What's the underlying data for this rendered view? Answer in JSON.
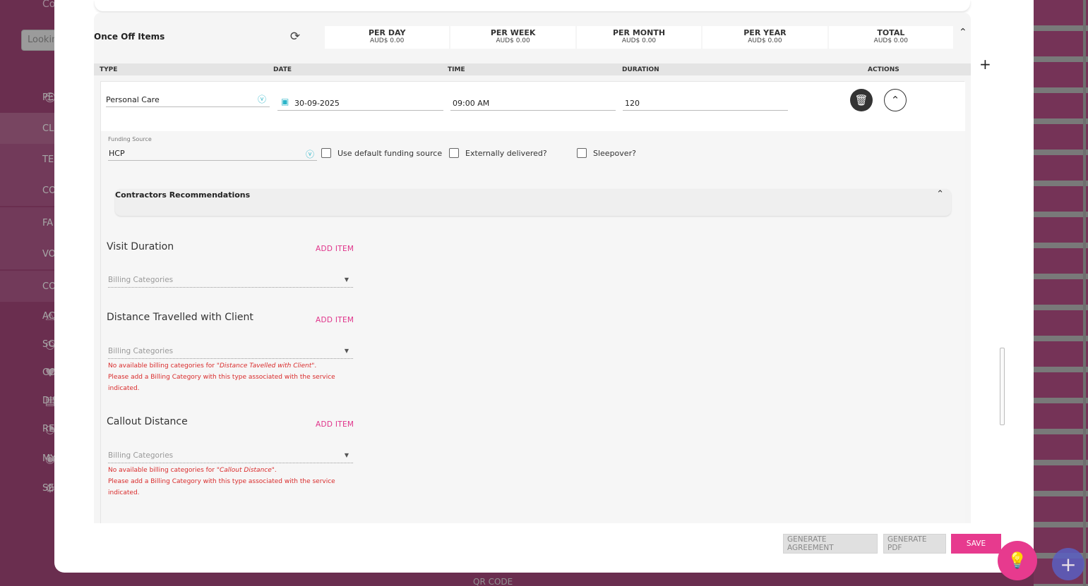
{
  "background": {
    "sidebar_search_placeholder": "Lookin",
    "sidebar_top_text": "Co",
    "sidebar_items": [
      "PE",
      "CL",
      "TE",
      "CO",
      "FA",
      "VO",
      "CO",
      "AC",
      "SC",
      "CO",
      "DIS",
      "RE",
      "MY",
      "SE"
    ],
    "bottom_text": "QR CODE"
  },
  "section": {
    "title": "Once Off Items",
    "totals": [
      {
        "label": "PER DAY",
        "value": "AUD$ 0.00"
      },
      {
        "label": "PER WEEK",
        "value": "AUD$ 0.00"
      },
      {
        "label": "PER MONTH",
        "value": "AUD$ 0.00"
      },
      {
        "label": "PER YEAR",
        "value": "AUD$ 0.00"
      },
      {
        "label": "TOTAL",
        "value": "AUD$ 0.00"
      }
    ],
    "columns": {
      "type": "TYPE",
      "date": "DATE",
      "time": "TIME",
      "duration": "DURATION",
      "actions": "ACTIONS"
    }
  },
  "item": {
    "type": "Personal Care",
    "date": "30-09-2025",
    "time": "09:00 AM",
    "duration": "120",
    "funding_source_label": "Funding Source",
    "funding_source": "HCP",
    "use_default_label": "Use default funding source",
    "externally_label": "Externally delivered?",
    "sleepover_label": "Sleepover?",
    "contractors_title": "Contractors Recommendations"
  },
  "blocks": [
    {
      "title": "Visit Duration",
      "add": "ADD ITEM",
      "select_placeholder": "Billing Categories"
    },
    {
      "title": "Distance Travelled with Client",
      "add": "ADD ITEM",
      "select_placeholder": "Billing Categories",
      "error_prefix": "No available billing categories for ",
      "error_name": "\"Distance Tavelled with Client\"",
      "error_suffix": ".",
      "error_line2": "Please add a Billing Category with this type associated with the service",
      "error_line3": "indicated."
    },
    {
      "title": "Callout Distance",
      "add": "ADD ITEM",
      "select_placeholder": "Billing Categories",
      "error_prefix": "No available billing categories for ",
      "error_name": "\"Callout Distance\"",
      "error_suffix": ".",
      "error_line2": "Please add a Billing Category with this type associated with the service",
      "error_line3": "indicated."
    }
  ],
  "footer": {
    "generate_agreement": "GENERATE AGREEMENT",
    "generate_pdf": "GENERATE PDF",
    "save": "SAVE"
  },
  "colors": {
    "accent": "#e73a8e",
    "cyan": "#2bb5c9",
    "error": "#d92b2b",
    "fab_secondary": "#5a5fc0"
  },
  "icons": [
    "refresh-icon",
    "chevron-up-icon",
    "calendar-icon",
    "cyan-dropdown-icon",
    "trash-icon",
    "plus-icon",
    "lightbulb-icon"
  ]
}
